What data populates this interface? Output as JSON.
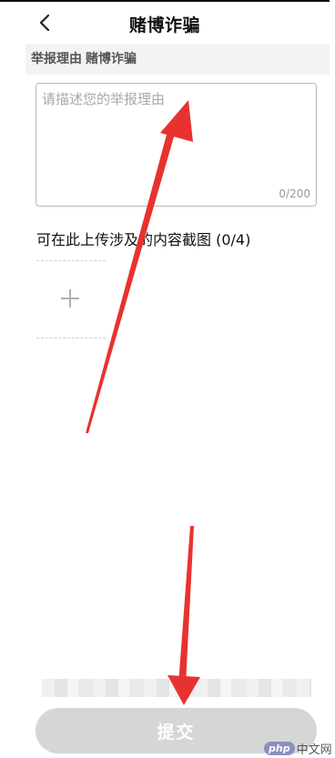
{
  "header": {
    "title": "赌博诈骗",
    "back_icon": "chevron-left-icon"
  },
  "reason_bar": {
    "label": "举报理由",
    "value": "赌博诈骗"
  },
  "reason_input": {
    "placeholder": "请描述您的举报理由",
    "value": "",
    "char_count": "0/200"
  },
  "upload": {
    "label": "可在此上传涉及的内容截图 (0/4)",
    "add_icon": "plus-icon"
  },
  "submit": {
    "label": "提交"
  },
  "watermark": {
    "logo": "php",
    "text": "中文网"
  },
  "colors": {
    "annotation_arrow": "#e8322f",
    "submit_disabled": "#d6d6d6"
  }
}
